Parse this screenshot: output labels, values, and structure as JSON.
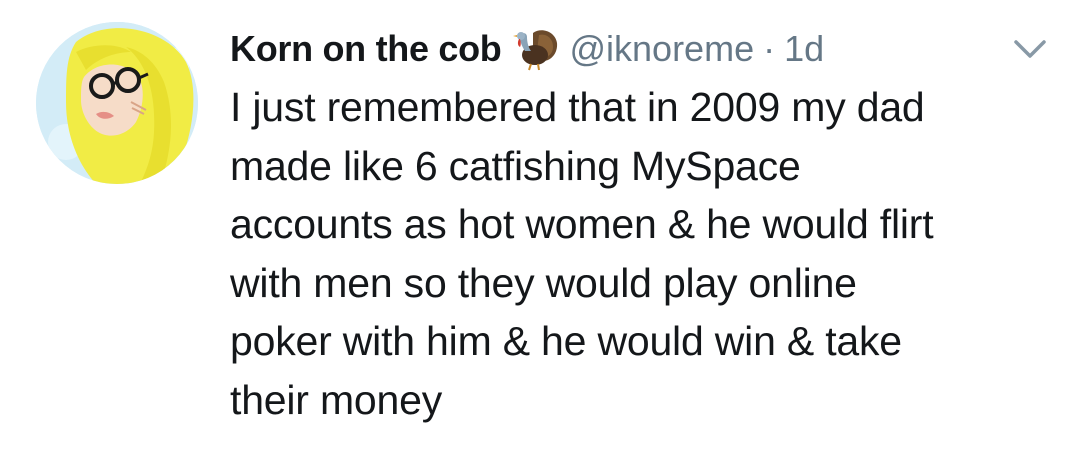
{
  "tweet": {
    "display_name": "Korn on the cob",
    "emoji_icon": "turkey-icon",
    "handle": "@iknoreme",
    "separator": "·",
    "time": "1d",
    "menu_icon": "chevron-down-icon",
    "lines": [
      "I just remembered that in 2009 my dad",
      "made like 6 catfishing MySpace",
      "accounts as hot women & he would flirt",
      "with men so they would play online",
      "poker with him & he would win & take",
      "their money"
    ]
  },
  "colors": {
    "text": "#14171a",
    "muted": "#657786",
    "avatar_bg": "#cfeaf6",
    "hair": "#f3ef4a"
  }
}
